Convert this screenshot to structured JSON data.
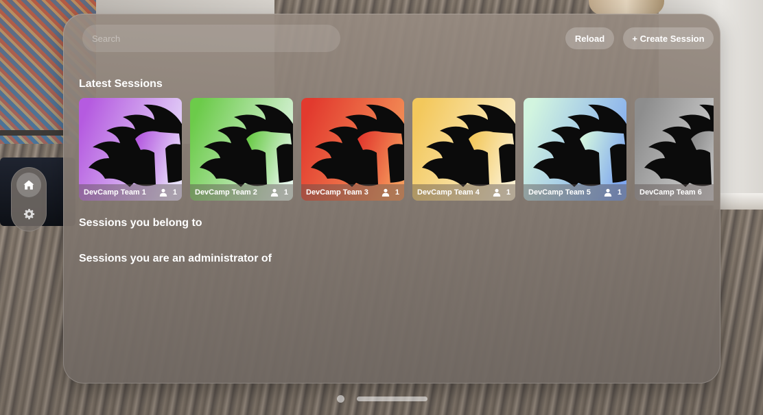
{
  "search": {
    "placeholder": "Search"
  },
  "toolbar": {
    "reload_label": "Reload",
    "create_label": "+ Create Session"
  },
  "sections": {
    "latest": "Latest Sessions",
    "belong": "Sessions you belong to",
    "admin": "Sessions you are an administrator of"
  },
  "sessions": [
    {
      "name": "DevCamp Team 1",
      "members": "1",
      "color_a": "#b55be0",
      "color_b": "#e9e2fb"
    },
    {
      "name": "DevCamp Team 2",
      "members": "1",
      "color_a": "#6ccb4a",
      "color_b": "#e5f6ea"
    },
    {
      "name": "DevCamp Team 3",
      "members": "1",
      "color_a": "#e23a2e",
      "color_b": "#f59a5c"
    },
    {
      "name": "DevCamp Team 4",
      "members": "1",
      "color_a": "#f3c85c",
      "color_b": "#fbf0d0"
    },
    {
      "name": "DevCamp Team 5",
      "members": "1",
      "color_a": "#d2f5df",
      "color_b": "#7ea6ef"
    },
    {
      "name": "DevCamp Team 6",
      "members": "",
      "color_a": "#8d8d8d",
      "color_b": "#e2e2e2"
    }
  ],
  "ornament": {
    "home_icon": "home-icon",
    "settings_icon": "gear-icon"
  }
}
